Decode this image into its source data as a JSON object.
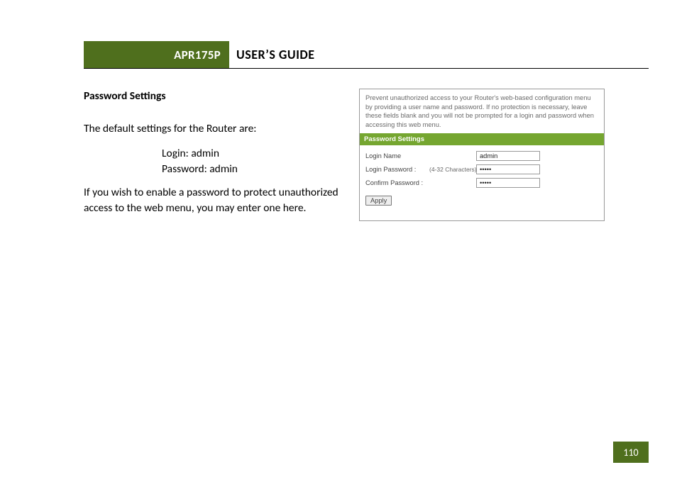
{
  "header": {
    "model": "APR175P",
    "title": "USER’S GUIDE"
  },
  "section": {
    "heading": "Password Settings",
    "intro": "The default settings for the Router are:",
    "login_line": "Login: admin",
    "password_line": "Password: admin",
    "body": "If you wish to enable a password to protect unauthorized access to the web menu, you may enter one here."
  },
  "screenshot": {
    "note": "Prevent unauthorized access to your Router's web-based configuration menu by providing a user name and password. If no protection is necessary, leave these fields blank and you will not be prompted for a login and password when accessing this web menu.",
    "bar": "Password Settings",
    "login_name_label": "Login Name",
    "login_name_value": "admin",
    "login_password_label": "Login Password :",
    "login_password_hint": "(4-32 Characters)",
    "login_password_value": "•••••",
    "confirm_password_label": "Confirm Password :",
    "confirm_password_value": "•••••",
    "apply": "Apply"
  },
  "page_number": "110"
}
